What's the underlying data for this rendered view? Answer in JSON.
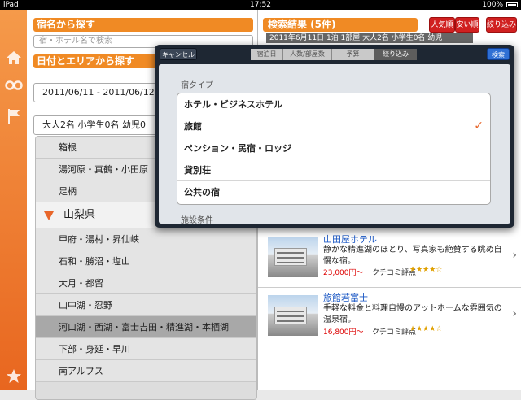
{
  "status": {
    "left": "iPad",
    "center": "17:52",
    "right": "100%"
  },
  "left_nav": {
    "home_icon": "home-icon",
    "glasses_icon": "glasses-icon",
    "flag_icon": "flag-icon",
    "star_icon": "star-icon"
  },
  "name_search": {
    "title": "宿名から探す",
    "placeholder": "宿・ホテル名で検索"
  },
  "date_area": {
    "title": "日付とエリアから探す",
    "dates": "2011/06/11 - 2011/06/12",
    "people": "大人2名 小学生0名 幼児0"
  },
  "areas": [
    {
      "label": "箱根",
      "type": "item"
    },
    {
      "label": "湯河原・真鶴・小田原",
      "type": "item"
    },
    {
      "label": "足柄",
      "type": "item"
    },
    {
      "label": "山梨県",
      "type": "pref"
    },
    {
      "label": "甲府・湯村・昇仙峡",
      "type": "item"
    },
    {
      "label": "石和・勝沼・塩山",
      "type": "item"
    },
    {
      "label": "大月・都留",
      "type": "item"
    },
    {
      "label": "山中湖・忍野",
      "type": "item"
    },
    {
      "label": "河口湖・西湖・富士吉田・精進湖・本栖湖",
      "type": "item",
      "selected": true
    },
    {
      "label": "下部・身延・早川",
      "type": "item"
    },
    {
      "label": "南アルプス",
      "type": "item"
    }
  ],
  "results": {
    "title": "検索結果 (5件)",
    "sort_popular": "人気順",
    "sort_cheap": "安い順",
    "filter": "絞り込み",
    "condition": "2011年6月11日 1泊 1部屋 大人2名 小学生0名 幼児",
    "rating_label": "クチコミ評点",
    "hotels": [
      {
        "name": "山田屋ホテル",
        "desc": "静かな精進湖のほとり、写真家も絶賛する眺め自慢な宿。",
        "price": "23,000円〜",
        "stars": "★★★★☆"
      },
      {
        "name": "旅館若富士",
        "desc": "手軽な料金と料理自慢のアットホームな雰囲気の温泉宿。",
        "price": "16,800円〜",
        "stars": "★★★★☆"
      }
    ]
  },
  "popover": {
    "cancel": "キャンセル",
    "search": "検索",
    "tabs": [
      "宿泊日",
      "人数/部屋数",
      "予算",
      "絞り込み"
    ],
    "section_type": "宿タイプ",
    "options": [
      "ホテル・ビジネスホテル",
      "旅館",
      "ペンション・民宿・ロッジ",
      "貸別荘",
      "公共の宿"
    ],
    "checked_index": 1,
    "section_facility": "施設条件"
  },
  "colors": {
    "accent": "#f08a24",
    "check": "#e8662a",
    "link": "#1a57c4",
    "price": "#dd0000"
  }
}
